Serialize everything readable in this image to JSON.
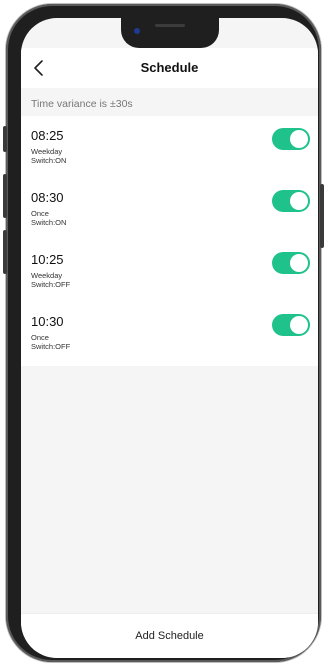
{
  "header": {
    "title": "Schedule",
    "back_icon": "chevron-left-icon"
  },
  "variance_text": "Time variance is  ±30s",
  "schedules": [
    {
      "time": "08:25",
      "repeat": "Weekday",
      "action": "Switch:ON",
      "enabled": true
    },
    {
      "time": "08:30",
      "repeat": "Once",
      "action": "Switch:ON",
      "enabled": true
    },
    {
      "time": "10:25",
      "repeat": "Weekday",
      "action": "Switch:OFF",
      "enabled": true
    },
    {
      "time": "10:30",
      "repeat": "Once",
      "action": "Switch:OFF",
      "enabled": true
    }
  ],
  "bottom": {
    "add_label": "Add Schedule"
  },
  "colors": {
    "toggle_on": "#1fc28b",
    "background": "#f5f5f5"
  }
}
